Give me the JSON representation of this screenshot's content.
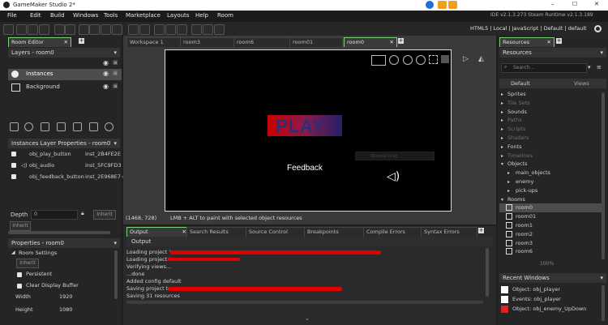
{
  "window": {
    "title": "GameMaker Studio 2*",
    "min": "–",
    "max": "☐",
    "close": "✕"
  },
  "menu": [
    "File",
    "Edit",
    "Build",
    "Windows",
    "Tools",
    "Marketplace",
    "Layouts",
    "Help",
    "Room"
  ],
  "ide_info": "IDE v2.1.3.273 Steam Runtime v2.1.3.189",
  "target_info": "HTML5 | Local | JavaScript | Default | default",
  "left": {
    "room_editor_tab": "Room Editor",
    "layers_header": "Layers - room0",
    "layers": [
      "Instances",
      "Background"
    ],
    "instance_props_header": "Instances Layer Properties - room0",
    "instances": [
      {
        "name": "obj_play_button",
        "id": "inst_2B4FE2E"
      },
      {
        "name": "obj_audio",
        "id": "inst_5FC9FD3"
      },
      {
        "name": "obj_feedback_button",
        "id": "inst_2E968E7"
      }
    ],
    "depth_label": "Depth",
    "depth_value": "0",
    "inherit": "Inherit",
    "props_header": "Properties - room0",
    "room_settings": "Room Settings",
    "persistent": "Persistent",
    "clear_display": "Clear Display Buffer",
    "width_label": "Width",
    "width_value": "1920",
    "height_label": "Height",
    "height_value": "1080"
  },
  "center": {
    "tabs": [
      "Workspace 1",
      "room3",
      "room6",
      "room01",
      "room0"
    ],
    "play_text": "PLAY",
    "window_text": "Window Drag",
    "feedback_text": "Feedback",
    "coords": "(1468, 728)",
    "hint": "LMB + ALT to paint with selected object resources"
  },
  "output": {
    "tabs": [
      "Output",
      "Search Results",
      "Source Control",
      "Breakpoints",
      "Compile Errors",
      "Syntax Errors"
    ],
    "title": "Output",
    "lines": [
      "Loading project '",
      "Loading project '",
      "Verifying views...",
      "...done",
      "Added config default",
      "Saving project to:",
      "Saving 31 resources"
    ]
  },
  "right": {
    "tab": "Resources",
    "header": "Resources",
    "search_placeholder": "Search...",
    "default_label": "Default",
    "views_label": "Views",
    "tree": [
      {
        "label": "Sprites",
        "dim": false,
        "indent": 0
      },
      {
        "label": "Tile Sets",
        "dim": true,
        "indent": 0
      },
      {
        "label": "Sounds",
        "dim": false,
        "indent": 0
      },
      {
        "label": "Paths",
        "dim": true,
        "indent": 0
      },
      {
        "label": "Scripts",
        "dim": true,
        "indent": 0
      },
      {
        "label": "Shaders",
        "dim": true,
        "indent": 0
      },
      {
        "label": "Fonts",
        "dim": false,
        "indent": 0
      },
      {
        "label": "Timelines",
        "dim": true,
        "indent": 0
      },
      {
        "label": "Objects",
        "dim": false,
        "indent": 0
      },
      {
        "label": "main_objects",
        "dim": false,
        "indent": 1
      },
      {
        "label": "enemy",
        "dim": false,
        "indent": 1
      },
      {
        "label": "pick-ups",
        "dim": false,
        "indent": 1
      },
      {
        "label": "Rooms",
        "dim": false,
        "indent": 0
      },
      {
        "label": "room0",
        "dim": false,
        "indent": 1,
        "room": true
      },
      {
        "label": "room01",
        "dim": false,
        "indent": 1,
        "room": true
      },
      {
        "label": "room1",
        "dim": false,
        "indent": 1,
        "room": true
      },
      {
        "label": "room2",
        "dim": false,
        "indent": 1,
        "room": true
      },
      {
        "label": "room3",
        "dim": false,
        "indent": 1,
        "room": true
      },
      {
        "label": "room6",
        "dim": false,
        "indent": 1,
        "room": true
      }
    ],
    "zoom": "100%",
    "recent_header": "Recent Windows",
    "recent": [
      {
        "label": "Object: obj_player",
        "color": "#ffffff"
      },
      {
        "label": "Events: obj_player",
        "color": "#ffffff"
      },
      {
        "label": "Object: obj_enemy_UpDown",
        "color": "#e02020"
      }
    ]
  },
  "colors": {
    "accent": "#7ad07a",
    "selected": "#4d4d4d",
    "red": "#e00000"
  }
}
